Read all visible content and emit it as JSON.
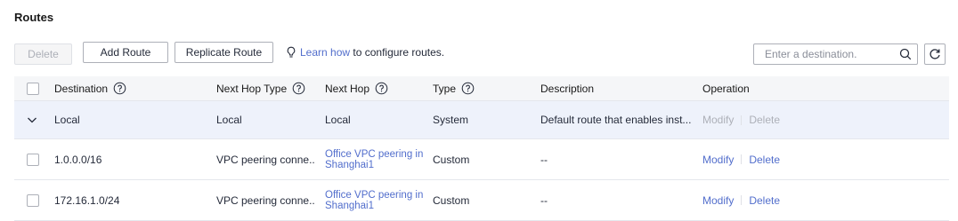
{
  "page": {
    "title": "Routes"
  },
  "toolbar": {
    "delete_label": "Delete",
    "add_route_label": "Add Route",
    "replicate_route_label": "Replicate Route",
    "hint_link": "Learn how",
    "hint_text": " to configure routes.",
    "search_placeholder": "Enter a destination."
  },
  "table": {
    "columns": [
      "Destination",
      "Next Hop Type",
      "Next Hop",
      "Type",
      "Description",
      "Operation"
    ],
    "rows": [
      {
        "destination": "Local",
        "next_hop_type": "Local",
        "next_hop": "Local",
        "type": "System",
        "description": "Default route that enables inst...",
        "modify": "Modify",
        "delete": "Delete",
        "expanded_row": true,
        "operations_disabled": true
      },
      {
        "destination": "1.0.0.0/16",
        "next_hop_type": "VPC peering conne...",
        "next_hop": "Office VPC peering in Shanghai1",
        "type": "Custom",
        "description": "--",
        "modify": "Modify",
        "delete": "Delete"
      },
      {
        "destination": "172.16.1.0/24",
        "next_hop_type": "VPC peering conne...",
        "next_hop": "Office VPC peering in Shanghai1",
        "type": "Custom",
        "description": "--",
        "modify": "Modify",
        "delete": "Delete"
      }
    ]
  },
  "icons": [
    "lightbulb-icon",
    "search-icon",
    "refresh-icon",
    "help-icon",
    "chevron-down-icon"
  ],
  "colors": {
    "link": "#526ecc",
    "disabled": "#adb0b8",
    "header_bg": "#f5f6f8",
    "expanded_row_bg": "#eef2fb"
  }
}
